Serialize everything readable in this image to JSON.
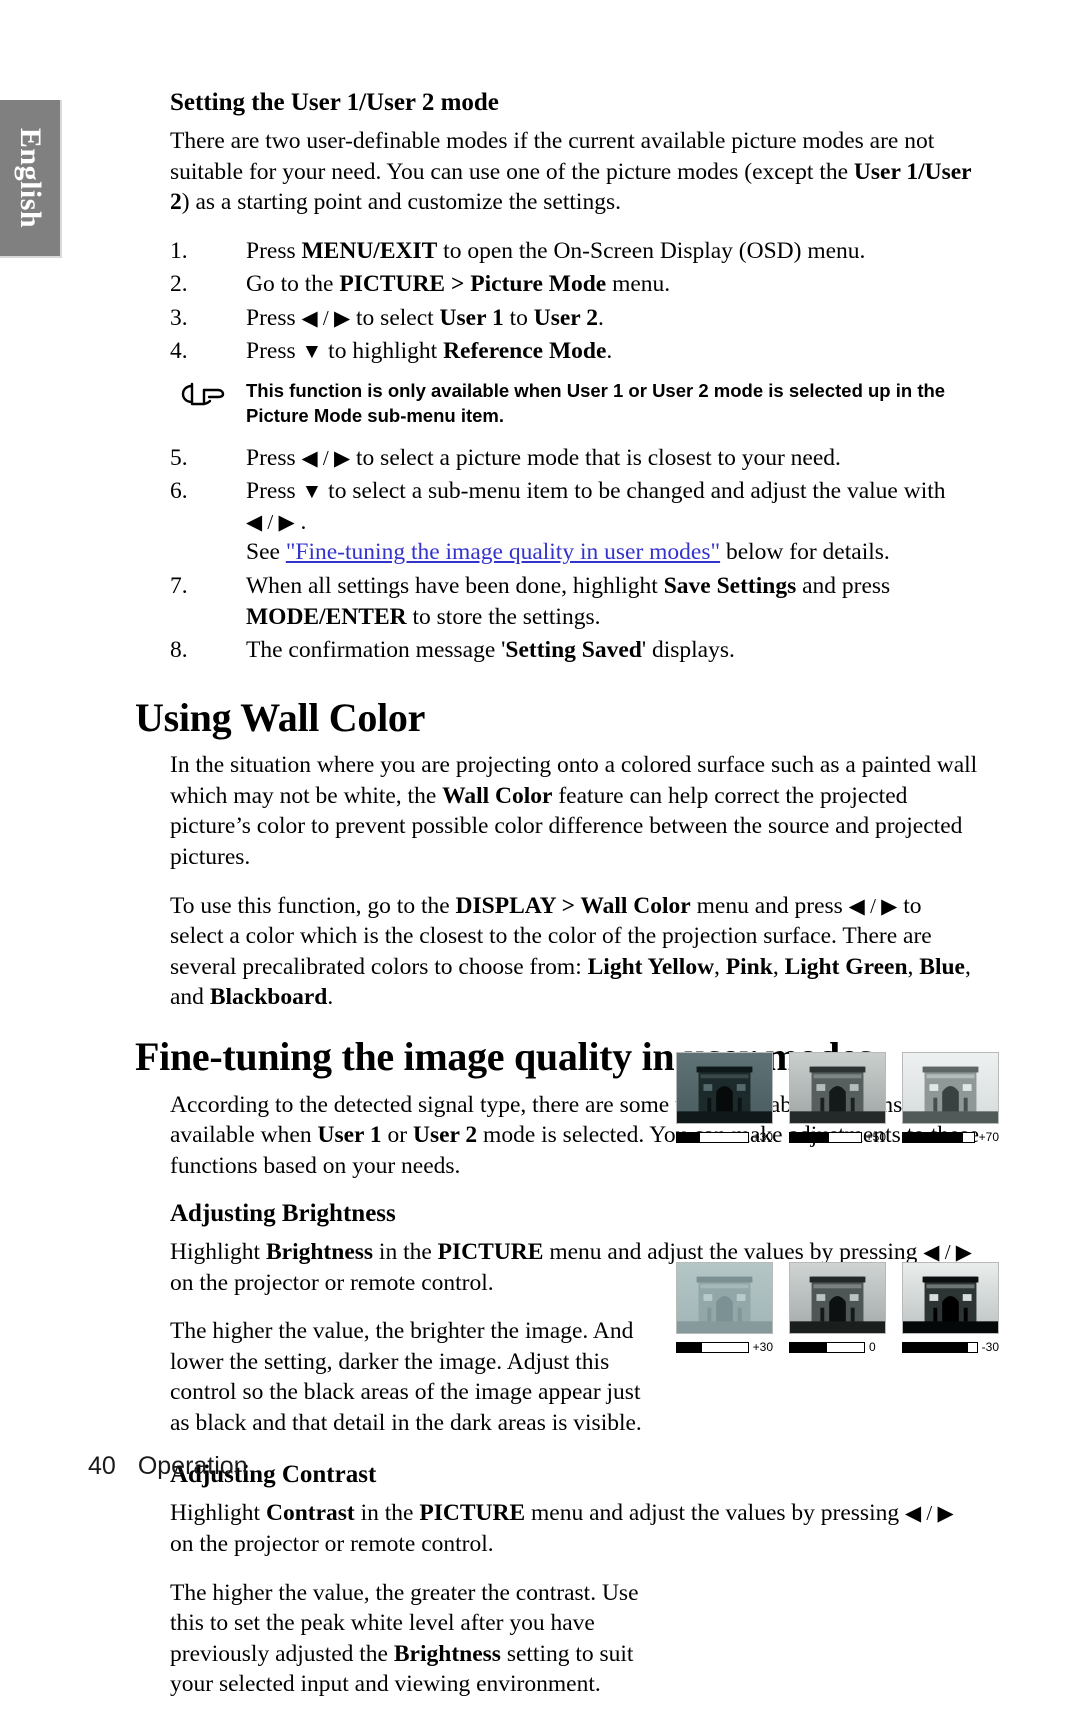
{
  "language_tab": {
    "label": "English"
  },
  "sections": {
    "user_mode": {
      "heading": "Setting the User 1/User 2 mode",
      "intro_1": "There are two user-definable modes if the current available picture modes are not suitable for your need. You can use one of the picture modes (except the ",
      "intro_1_bold": "User 1/User 2",
      "intro_1_end": ") as a starting point and customize the settings.",
      "steps": [
        {
          "num": "1.",
          "pre": "Press ",
          "bold1": "MENU/EXIT",
          "post": " to open the On-Screen Display (OSD) menu."
        },
        {
          "num": "2.",
          "pre": "Go to the ",
          "bold1": "PICTURE",
          "mid": " > ",
          "bold2": "Picture Mode",
          "post": " menu."
        },
        {
          "num": "3.",
          "pre": "Press ",
          "arrows": "◀ / ▶",
          "mid": " to select ",
          "bold1": "User 1",
          "mid2": " to ",
          "bold2": "User 2",
          "post": "."
        },
        {
          "num": "4.",
          "pre": "Press ",
          "arrows": "▼",
          "mid": " to highlight ",
          "bold1": "Reference Mode",
          "post": "."
        }
      ],
      "note": "This function is only available when User 1 or User 2 mode is selected up in the Picture Mode sub-menu item.",
      "note_icon": "pointing-hand-icon",
      "steps_2": [
        {
          "num": "5.",
          "pre": "Press ",
          "arrows": "◀ / ▶",
          "post": " to select a picture mode that is closest to your need."
        },
        {
          "num": "6.",
          "pre": "Press ",
          "arrows": "▼",
          "mid": " to select a sub-menu item to be changed and adjust the value with ",
          "arrows2": "◀ / ▶",
          "post": " .",
          "line2_pre": "See ",
          "line2_link": "\"Fine-tuning the image quality in user modes\"",
          "line2_post": " below for details."
        },
        {
          "num": "7.",
          "pre": "When all settings have been done, highlight ",
          "bold1": "Save Settings",
          "mid": " and press ",
          "bold2": "MODE/ENTER",
          "post": " to store the settings."
        },
        {
          "num": "8.",
          "pre": "The confirmation message '",
          "bold1": "Setting Saved",
          "post": "' displays."
        }
      ]
    },
    "wall_color": {
      "heading": "Using Wall Color",
      "para_1_a": "In the situation where you are projecting onto a colored surface such as a painted wall which may not be white, the ",
      "para_1_b": "Wall Color",
      "para_1_c": " feature can help correct the projected picture’s color to prevent possible color difference between the source and projected pictures.",
      "para_2_a": "To use this function, go to the ",
      "para_2_b": "DISPLAY",
      "para_2_c": " > ",
      "para_2_d": "Wall Color",
      "para_2_e": " menu and press ",
      "para_2_arrows": "◀ / ▶",
      "para_2_f": " to select a color which is the closest to the color of the projection surface. There are several precalibrated colors to choose from: ",
      "color_options": [
        "Light Yellow",
        "Pink",
        "Light Green",
        "Blue"
      ],
      "para_2_g": ", and ",
      "para_2_h": "Blackboard",
      "para_2_i": "."
    },
    "fine_tuning": {
      "heading": "Fine-tuning the image quality in user modes",
      "para_a": "According to the detected signal type, there are some user-definable functions available when ",
      "para_b": "User 1",
      "para_c": " or ",
      "para_d": "User 2",
      "para_e": " mode is selected. You can make adjustments to these functions based on your needs."
    },
    "brightness": {
      "heading": "Adjusting Brightness",
      "para_a": "Highlight ",
      "para_b": "Brightness",
      "para_c": " in the ",
      "para_d": "PICTURE",
      "para_e": " menu and adjust the values by pressing ",
      "para_arrows": "◀ / ▶",
      "para_f": " on the projector or remote control.",
      "para_2": "The higher the value, the brighter the image. And lower the setting, darker the image. Adjust this control so the black areas of the image appear just as black and that detail in the dark areas is visible.",
      "samples": [
        {
          "value": "+30",
          "fill_percent": 33,
          "image": "arc-de-triomphe-dark"
        },
        {
          "value": "+50",
          "fill_percent": 55,
          "image": "arc-de-triomphe-medium"
        },
        {
          "value": "+70",
          "fill_percent": 85,
          "image": "arc-de-triomphe-bright"
        }
      ]
    },
    "contrast": {
      "heading": "Adjusting Contrast",
      "para_a": "Highlight ",
      "para_b": "Contrast",
      "para_c": " in the ",
      "para_d": "PICTURE",
      "para_e": " menu and adjust the values by pressing ",
      "para_arrows": "◀ / ▶",
      "para_f": " on the projector or remote control.",
      "para_2_a": "The higher the value, the greater the contrast. Use this to set the peak white level after you have previously adjusted the ",
      "para_2_b": "Brightness",
      "para_2_c": " setting to suit your selected input and viewing environment.",
      "samples": [
        {
          "value": "+30",
          "fill_percent": 35,
          "image": "arc-de-triomphe-low-contrast"
        },
        {
          "value": "0",
          "fill_percent": 50,
          "image": "arc-de-triomphe-normal-contrast"
        },
        {
          "value": "-30",
          "fill_percent": 88,
          "image": "arc-de-triomphe-high-contrast"
        }
      ]
    }
  },
  "footer": {
    "page_number": "40",
    "chapter": "Operation"
  },
  "colors": {
    "link": "#3333cc",
    "tab_bg": "#808080",
    "tab_text": "#ffffff"
  }
}
